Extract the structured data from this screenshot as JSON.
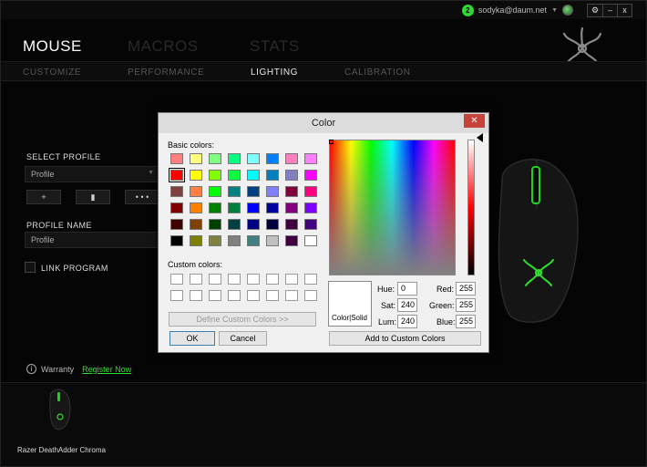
{
  "topbar": {
    "notif_count": "2",
    "user_email": "sodyka@daum.net",
    "win_settings": "⚙",
    "win_minimize": "–",
    "win_close": "x"
  },
  "nav": {
    "main": [
      "MOUSE",
      "MACROS",
      "STATS"
    ],
    "sub": [
      "CUSTOMIZE",
      "PERFORMANCE",
      "LIGHTING",
      "CALIBRATION"
    ]
  },
  "left": {
    "select_profile_label": "SELECT PROFILE",
    "profile_value": "Profile",
    "add_btn": "+",
    "delete_btn": "▮",
    "more_btn": "• • •",
    "profile_name_label": "PROFILE NAME",
    "profile_name_value": "Profile",
    "link_program_label": "LINK PROGRAM"
  },
  "footer": {
    "warranty_label": "Warranty",
    "register_link": "Register Now",
    "device_name": "Razer DeathAdder Chroma"
  },
  "dialog": {
    "title": "Color",
    "close": "✕",
    "basic_colors_label": "Basic colors:",
    "custom_colors_label": "Custom colors:",
    "define_custom_btn": "Define Custom Colors >>",
    "ok_btn": "OK",
    "cancel_btn": "Cancel",
    "add_custom_btn": "Add to Custom Colors",
    "color_solid_label": "Color|Solid",
    "hue_label": "Hue:",
    "sat_label": "Sat:",
    "lum_label": "Lum:",
    "red_label": "Red:",
    "green_label": "Green:",
    "blue_label": "Blue:",
    "hue": "0",
    "sat": "240",
    "lum": "240",
    "red": "255",
    "green": "255",
    "blue": "255"
  },
  "basic_colors": [
    [
      "#ff8080",
      "#ffff80",
      "#80ff80",
      "#00ff80",
      "#80ffff",
      "#0080ff",
      "#ff80c0",
      "#ff80ff"
    ],
    [
      "#ff0000",
      "#ffff00",
      "#80ff00",
      "#00ff40",
      "#00ffff",
      "#0080c0",
      "#8080c0",
      "#ff00ff"
    ],
    [
      "#804040",
      "#ff8040",
      "#00ff00",
      "#008080",
      "#004080",
      "#8080ff",
      "#800040",
      "#ff0080"
    ],
    [
      "#800000",
      "#ff8000",
      "#008000",
      "#008040",
      "#0000ff",
      "#0000a0",
      "#800080",
      "#8000ff"
    ],
    [
      "#400000",
      "#804000",
      "#004000",
      "#004040",
      "#000080",
      "#000040",
      "#400040",
      "#400080"
    ],
    [
      "#000000",
      "#808000",
      "#808040",
      "#808080",
      "#408080",
      "#c0c0c0",
      "#400040",
      "#ffffff"
    ]
  ],
  "selected_basic_color": "#ff0000",
  "accent_color": "#2fe02f"
}
